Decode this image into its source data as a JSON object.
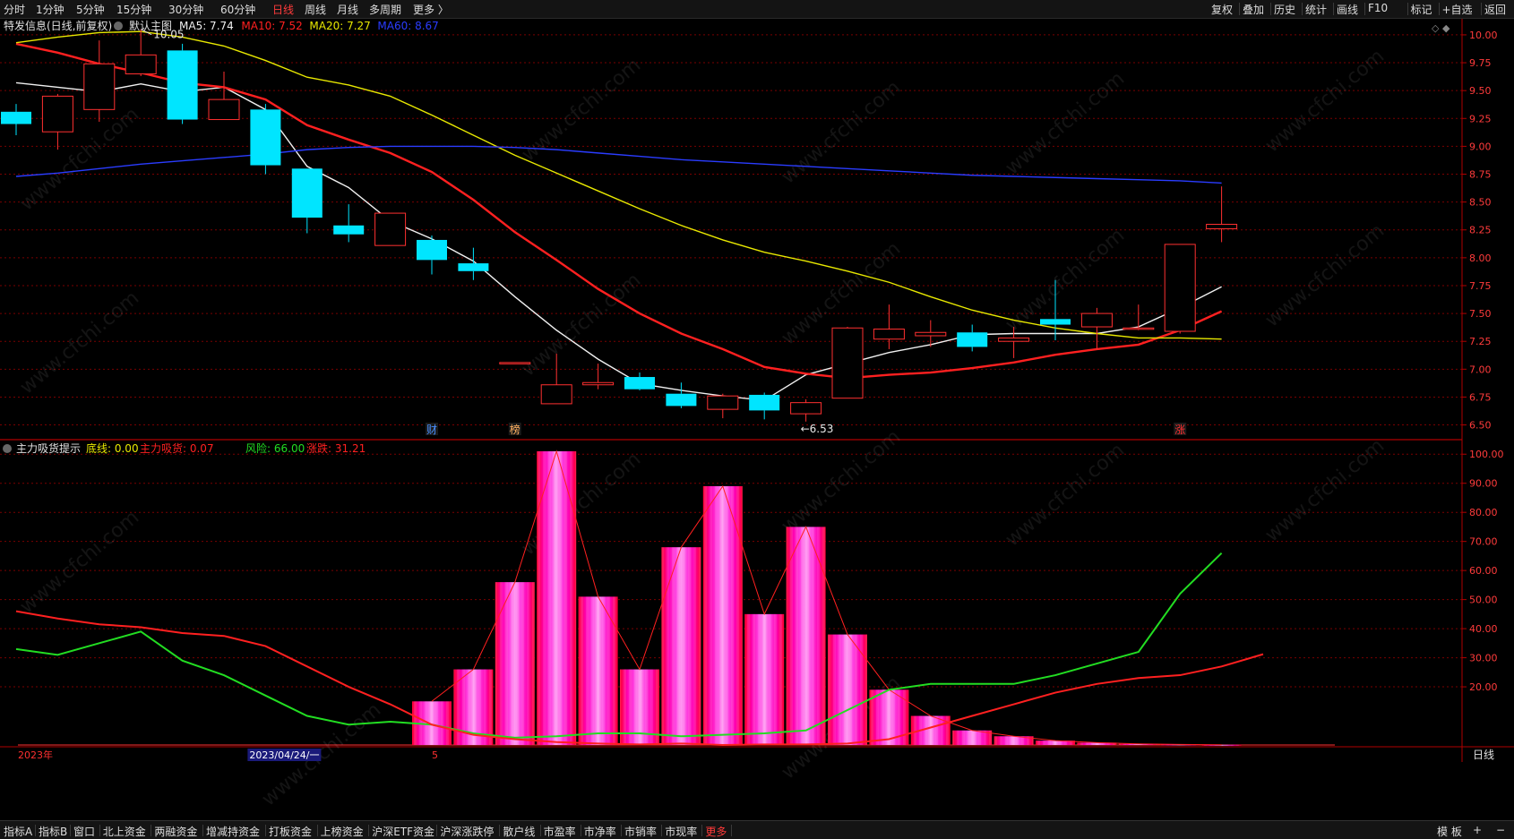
{
  "toolbar": {
    "periods": [
      "分时",
      "1分钟",
      "5分钟",
      "15分钟",
      "30分钟",
      "60分钟",
      "日线",
      "周线",
      "月线",
      "多周期",
      "更多 〉"
    ],
    "active_period": "日线",
    "tools": [
      "复权",
      "叠加",
      "历史",
      "统计",
      "画线",
      "F10",
      "标记",
      "+自选",
      "返回"
    ]
  },
  "main_panel": {
    "stock_name": "特发信息(日线,前复权)",
    "indicator_name": "默认主图",
    "legend": [
      {
        "label": "MA5: 7.74",
        "color": "#f0f0f0"
      },
      {
        "label": "MA10: 7.52",
        "color": "#ff2020"
      },
      {
        "label": "MA20: 7.27",
        "color": "#e8e800"
      },
      {
        "label": "MA60: 8.67",
        "color": "#2a3cff"
      }
    ],
    "high_label": "10.05",
    "low_label": "←6.53",
    "markers": [
      {
        "text": "财",
        "index": 10,
        "color": "#4a90ff"
      },
      {
        "text": "榜",
        "index": 12,
        "color": "#ffb060"
      },
      {
        "text": "涨",
        "index": 28,
        "color": "#ff3030"
      }
    ],
    "price_ticks": [
      "10.00",
      "9.75",
      "9.50",
      "9.25",
      "9.00",
      "8.75",
      "8.50",
      "8.25",
      "8.00",
      "7.75",
      "7.50",
      "7.25",
      "7.00",
      "6.75",
      "6.50"
    ],
    "watermark": "www.cfchi.com"
  },
  "sub_panel": {
    "indicator_name": "主力吸货提示",
    "legend": [
      {
        "label": "底线: 0.00",
        "color": "#e8e800"
      },
      {
        "label": "主力吸货: 0.07",
        "color": "#ff2020"
      },
      {
        "label": "风险: 66.00",
        "color": "#22dd22"
      },
      {
        "label": "涨跌: 31.21",
        "color": "#ff2020"
      }
    ],
    "value_ticks": [
      "100.00",
      "90.00",
      "80.00",
      "70.00",
      "60.00",
      "50.00",
      "40.00",
      "30.00",
      "20.00"
    ]
  },
  "timeline": {
    "labels": [
      {
        "text": "2023年",
        "index": 0,
        "highlight": false
      },
      {
        "text": "2023/04/24/一",
        "index": 6,
        "highlight": true
      },
      {
        "text": "5",
        "index": 10,
        "highlight": false
      }
    ],
    "period_label": "日线"
  },
  "bottombar": {
    "tabs": [
      "指标A",
      "指标B",
      "窗口",
      "北上资金",
      "两融资金",
      "增减持资金",
      "打板资金",
      "上榜资金",
      "沪深ETF资金",
      "沪深涨跌停",
      "散户线",
      "市盈率",
      "市净率",
      "市销率",
      "市现率",
      "更多"
    ],
    "active_tab": "更多",
    "right": [
      "模 板",
      "+",
      "−"
    ]
  },
  "colors": {
    "up": "#ff3030",
    "down": "#00e5ff",
    "grid": "#7a0000",
    "axis": "#b00000",
    "bar_magenta": "#ff00c8",
    "bar_red": "#ff0040"
  },
  "chart_data": [
    {
      "type": "candlestick",
      "title": "特发信息(日线,前复权)",
      "ylim": [
        6.4,
        10.12
      ],
      "candles": [
        {
          "o": 9.31,
          "h": 9.38,
          "l": 9.1,
          "c": 9.2
        },
        {
          "o": 9.13,
          "h": 9.47,
          "l": 8.97,
          "c": 9.45
        },
        {
          "o": 9.33,
          "h": 9.95,
          "l": 9.22,
          "c": 9.74
        },
        {
          "o": 9.65,
          "h": 10.05,
          "l": 9.63,
          "c": 9.82
        },
        {
          "o": 9.86,
          "h": 9.92,
          "l": 9.2,
          "c": 9.24
        },
        {
          "o": 9.24,
          "h": 9.67,
          "l": 9.24,
          "c": 9.42
        },
        {
          "o": 9.33,
          "h": 9.38,
          "l": 8.75,
          "c": 8.83
        },
        {
          "o": 8.8,
          "h": 8.8,
          "l": 8.22,
          "c": 8.36
        },
        {
          "o": 8.29,
          "h": 8.48,
          "l": 8.14,
          "c": 8.21
        },
        {
          "o": 8.11,
          "h": 8.4,
          "l": 8.11,
          "c": 8.4
        },
        {
          "o": 8.16,
          "h": 8.2,
          "l": 7.85,
          "c": 7.98
        },
        {
          "o": 7.95,
          "h": 8.09,
          "l": 7.8,
          "c": 7.88
        },
        {
          "o": 7.06,
          "h": 7.06,
          "l": 7.06,
          "c": 7.06
        },
        {
          "o": 6.69,
          "h": 7.14,
          "l": 6.69,
          "c": 6.86
        },
        {
          "o": 6.86,
          "h": 7.05,
          "l": 6.82,
          "c": 6.88
        },
        {
          "o": 6.93,
          "h": 6.97,
          "l": 6.81,
          "c": 6.82
        },
        {
          "o": 6.78,
          "h": 6.88,
          "l": 6.65,
          "c": 6.67
        },
        {
          "o": 6.64,
          "h": 6.78,
          "l": 6.56,
          "c": 6.76
        },
        {
          "o": 6.77,
          "h": 6.79,
          "l": 6.55,
          "c": 6.63
        },
        {
          "o": 6.6,
          "h": 6.73,
          "l": 6.53,
          "c": 6.7
        },
        {
          "o": 6.74,
          "h": 7.38,
          "l": 6.74,
          "c": 7.37
        },
        {
          "o": 7.27,
          "h": 7.58,
          "l": 7.18,
          "c": 7.36
        },
        {
          "o": 7.3,
          "h": 7.44,
          "l": 7.2,
          "c": 7.33
        },
        {
          "o": 7.33,
          "h": 7.4,
          "l": 7.16,
          "c": 7.2
        },
        {
          "o": 7.25,
          "h": 7.38,
          "l": 7.1,
          "c": 7.28
        },
        {
          "o": 7.45,
          "h": 7.8,
          "l": 7.26,
          "c": 7.4
        },
        {
          "o": 7.38,
          "h": 7.55,
          "l": 7.18,
          "c": 7.5
        },
        {
          "o": 7.37,
          "h": 7.58,
          "l": 7.35,
          "c": 7.37
        },
        {
          "o": 7.34,
          "h": 8.12,
          "l": 7.32,
          "c": 8.12
        },
        {
          "o": 8.26,
          "h": 8.64,
          "l": 8.14,
          "c": 8.3
        }
      ],
      "ma": [
        {
          "name": "MA5",
          "color": "#f0f0f0",
          "values": [
            9.57,
            9.53,
            9.49,
            9.56,
            9.49,
            9.53,
            9.33,
            8.82,
            8.63,
            8.33,
            8.17,
            7.97,
            7.65,
            7.35,
            7.09,
            6.87,
            6.81,
            6.76,
            6.72,
            6.95,
            7.05,
            7.15,
            7.22,
            7.31,
            7.32,
            7.32,
            7.32,
            7.38,
            7.55,
            7.74
          ]
        },
        {
          "name": "MA10",
          "color": "#ff2020",
          "values": [
            9.92,
            9.84,
            9.74,
            9.66,
            9.57,
            9.53,
            9.42,
            9.19,
            9.06,
            8.94,
            8.77,
            8.52,
            8.23,
            7.98,
            7.72,
            7.5,
            7.32,
            7.18,
            7.02,
            6.96,
            6.92,
            6.95,
            6.97,
            7.01,
            7.06,
            7.13,
            7.18,
            7.22,
            7.35,
            7.52
          ]
        },
        {
          "name": "MA20",
          "color": "#e8e800",
          "values": [
            9.93,
            9.98,
            10.02,
            10.03,
            9.98,
            9.9,
            9.77,
            9.62,
            9.55,
            9.45,
            9.28,
            9.1,
            8.92,
            8.76,
            8.6,
            8.44,
            8.29,
            8.16,
            8.05,
            7.97,
            7.88,
            7.78,
            7.65,
            7.53,
            7.44,
            7.37,
            7.32,
            7.28,
            7.28,
            7.27
          ]
        },
        {
          "name": "MA60",
          "color": "#2a3cff",
          "values": [
            8.73,
            8.76,
            8.8,
            8.84,
            8.87,
            8.9,
            8.93,
            8.97,
            8.99,
            9.0,
            9.0,
            9.0,
            8.99,
            8.97,
            8.94,
            8.91,
            8.88,
            8.86,
            8.84,
            8.82,
            8.8,
            8.78,
            8.76,
            8.74,
            8.73,
            8.72,
            8.71,
            8.7,
            8.69,
            8.67
          ]
        }
      ]
    },
    {
      "type": "bar",
      "title": "主力吸货提示",
      "ylim": [
        0,
        105
      ],
      "bars": [
        {
          "index": 10,
          "value": 15
        },
        {
          "index": 11,
          "value": 26
        },
        {
          "index": 12,
          "value": 56
        },
        {
          "index": 13,
          "value": 101
        },
        {
          "index": 14,
          "value": 51
        },
        {
          "index": 15,
          "value": 26
        },
        {
          "index": 16,
          "value": 68
        },
        {
          "index": 17,
          "value": 89
        },
        {
          "index": 18,
          "value": 45
        },
        {
          "index": 19,
          "value": 75
        },
        {
          "index": 20,
          "value": 38
        },
        {
          "index": 21,
          "value": 19
        },
        {
          "index": 22,
          "value": 10
        },
        {
          "index": 23,
          "value": 5
        },
        {
          "index": 24,
          "value": 3
        },
        {
          "index": 25,
          "value": 1.5
        },
        {
          "index": 26,
          "value": 0.8
        },
        {
          "index": 27,
          "value": 0.4
        },
        {
          "index": 28,
          "value": 0.2
        },
        {
          "index": 29,
          "value": 0.07
        }
      ],
      "series": [
        {
          "name": "风险",
          "color": "#22dd22",
          "values": [
            33,
            31,
            35,
            39,
            29,
            24,
            17,
            10,
            7,
            8,
            7,
            4,
            2.5,
            3,
            4,
            4,
            3,
            3.5,
            4,
            5,
            12,
            19,
            21,
            21,
            21,
            24,
            28,
            32,
            52,
            66
          ]
        },
        {
          "name": "涨跌",
          "color": "#ff2020",
          "values": [
            46,
            43.5,
            41.5,
            40.5,
            38.5,
            37.5,
            34,
            27,
            20,
            14,
            7,
            3.5,
            2,
            1,
            0.5,
            0.2,
            0.5,
            0,
            0.2,
            0.2,
            0.5,
            2,
            6,
            10,
            14,
            18,
            21,
            23,
            24,
            27,
            31.21
          ]
        },
        {
          "name": "底线",
          "color": "#e8e800",
          "values": [
            0,
            0,
            0,
            0,
            0,
            0,
            0,
            0,
            0,
            0,
            0,
            0,
            0,
            0,
            0,
            0,
            0,
            0,
            0,
            0,
            0,
            0,
            0,
            0,
            0,
            0,
            0,
            0,
            0,
            0
          ]
        }
      ]
    }
  ]
}
